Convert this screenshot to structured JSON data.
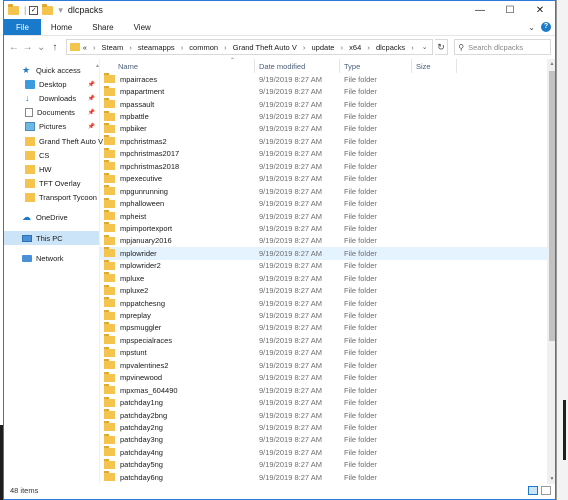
{
  "window": {
    "title": "dlcpacks",
    "controls": {
      "minimize": "—",
      "maximize": "☐",
      "close": "✕"
    }
  },
  "ribbon": {
    "tabs": [
      "File",
      "Home",
      "Share",
      "View"
    ],
    "help": "?"
  },
  "address": {
    "back": "←",
    "forward": "→",
    "recent": "⌄",
    "up": "↑",
    "overflow": "«",
    "segments": [
      "Steam",
      "steamapps",
      "common",
      "Grand Theft Auto V",
      "update",
      "x64",
      "dlcpacks"
    ],
    "search_placeholder": "Search dlcpacks"
  },
  "sidebar": {
    "quick_access": "Quick access",
    "pinned": [
      "Desktop",
      "Downloads",
      "Documents",
      "Pictures"
    ],
    "folders": [
      "Grand Theft Auto V",
      "CS",
      "HW",
      "TFT Overlay",
      "Transport Tycoon"
    ],
    "onedrive": "OneDrive",
    "this_pc": "This PC",
    "network": "Network"
  },
  "columns": {
    "name": "Name",
    "date": "Date modified",
    "type": "Type",
    "size": "Size"
  },
  "rows": [
    {
      "name": "mpairraces",
      "date": "9/19/2019 8:27 AM",
      "type": "File folder"
    },
    {
      "name": "mpapartment",
      "date": "9/19/2019 8:27 AM",
      "type": "File folder"
    },
    {
      "name": "mpassault",
      "date": "9/19/2019 8:27 AM",
      "type": "File folder"
    },
    {
      "name": "mpbattle",
      "date": "9/19/2019 8:27 AM",
      "type": "File folder"
    },
    {
      "name": "mpbiker",
      "date": "9/19/2019 8:27 AM",
      "type": "File folder"
    },
    {
      "name": "mpchristmas2",
      "date": "9/19/2019 8:27 AM",
      "type": "File folder"
    },
    {
      "name": "mpchristmas2017",
      "date": "9/19/2019 8:27 AM",
      "type": "File folder"
    },
    {
      "name": "mpchristmas2018",
      "date": "9/19/2019 8:27 AM",
      "type": "File folder"
    },
    {
      "name": "mpexecutive",
      "date": "9/19/2019 8:27 AM",
      "type": "File folder"
    },
    {
      "name": "mpgunrunning",
      "date": "9/19/2019 8:27 AM",
      "type": "File folder"
    },
    {
      "name": "mphalloween",
      "date": "9/19/2019 8:27 AM",
      "type": "File folder"
    },
    {
      "name": "mpheist",
      "date": "9/19/2019 8:27 AM",
      "type": "File folder"
    },
    {
      "name": "mpimportexport",
      "date": "9/19/2019 8:27 AM",
      "type": "File folder"
    },
    {
      "name": "mpjanuary2016",
      "date": "9/19/2019 8:27 AM",
      "type": "File folder"
    },
    {
      "name": "mplowrider",
      "date": "9/19/2019 8:27 AM",
      "type": "File folder"
    },
    {
      "name": "mplowrider2",
      "date": "9/19/2019 8:27 AM",
      "type": "File folder"
    },
    {
      "name": "mpluxe",
      "date": "9/19/2019 8:27 AM",
      "type": "File folder"
    },
    {
      "name": "mpluxe2",
      "date": "9/19/2019 8:27 AM",
      "type": "File folder"
    },
    {
      "name": "mppatchesng",
      "date": "9/19/2019 8:27 AM",
      "type": "File folder"
    },
    {
      "name": "mpreplay",
      "date": "9/19/2019 8:27 AM",
      "type": "File folder"
    },
    {
      "name": "mpsmuggler",
      "date": "9/19/2019 8:27 AM",
      "type": "File folder"
    },
    {
      "name": "mpspecialraces",
      "date": "9/19/2019 8:27 AM",
      "type": "File folder"
    },
    {
      "name": "mpstunt",
      "date": "9/19/2019 8:27 AM",
      "type": "File folder"
    },
    {
      "name": "mpvalentines2",
      "date": "9/19/2019 8:27 AM",
      "type": "File folder"
    },
    {
      "name": "mpvinewood",
      "date": "9/19/2019 8:27 AM",
      "type": "File folder"
    },
    {
      "name": "mpxmas_604490",
      "date": "9/19/2019 8:27 AM",
      "type": "File folder"
    },
    {
      "name": "patchday1ng",
      "date": "9/19/2019 8:27 AM",
      "type": "File folder"
    },
    {
      "name": "patchday2bng",
      "date": "9/19/2019 8:27 AM",
      "type": "File folder"
    },
    {
      "name": "patchday2ng",
      "date": "9/19/2019 8:27 AM",
      "type": "File folder"
    },
    {
      "name": "patchday3ng",
      "date": "9/19/2019 8:27 AM",
      "type": "File folder"
    },
    {
      "name": "patchday4ng",
      "date": "9/19/2019 8:27 AM",
      "type": "File folder"
    },
    {
      "name": "patchday5ng",
      "date": "9/19/2019 8:27 AM",
      "type": "File folder"
    },
    {
      "name": "patchday6ng",
      "date": "9/19/2019 8:27 AM",
      "type": "File folder"
    }
  ],
  "hover_row": "mplowrider",
  "status": {
    "count": "48 items"
  },
  "colors": {
    "accent": "#1979ca",
    "folder": "#f4c44e",
    "selection": "#cce4f7",
    "hover": "#e5f3ff"
  }
}
